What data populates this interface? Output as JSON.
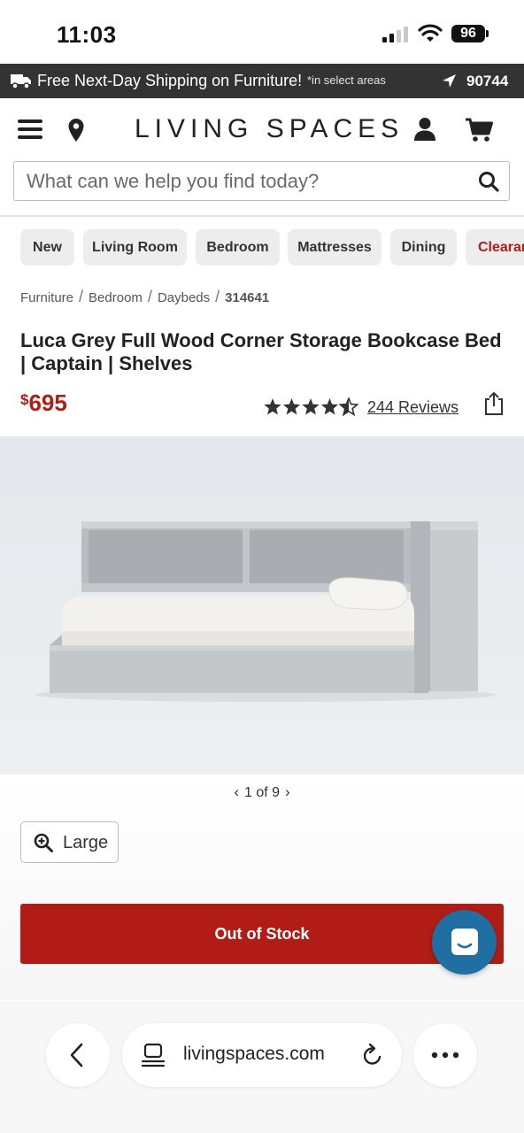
{
  "status_bar": {
    "time": "11:03",
    "battery": "96"
  },
  "promo": {
    "text": "Free Next-Day Shipping on Furniture!",
    "note": "*in select areas",
    "zip": "90744"
  },
  "header": {
    "logo": "LIVING SPACES"
  },
  "search": {
    "placeholder": "What can we help you find today?"
  },
  "categories": [
    "New",
    "Living Room",
    "Bedroom",
    "Mattresses",
    "Dining",
    "Clearance"
  ],
  "breadcrumb": [
    "Furniture",
    "Bedroom",
    "Daybeds",
    "314641"
  ],
  "product": {
    "title": "Luca Grey Full Wood Corner Storage Bookcase Bed | Captain | Shelves",
    "currency": "$",
    "price": "695",
    "rating": 4.5,
    "reviews": "244 Reviews"
  },
  "carousel": {
    "prev": "‹",
    "position": "1 of 9",
    "next": "›"
  },
  "actions": {
    "large": "Large",
    "stock": "Out of Stock"
  },
  "browser": {
    "url": "livingspaces.com"
  },
  "colors": {
    "brand_red": "#b21c17",
    "promo_bar": "#333333",
    "chat_blue": "#1f6fa3"
  }
}
